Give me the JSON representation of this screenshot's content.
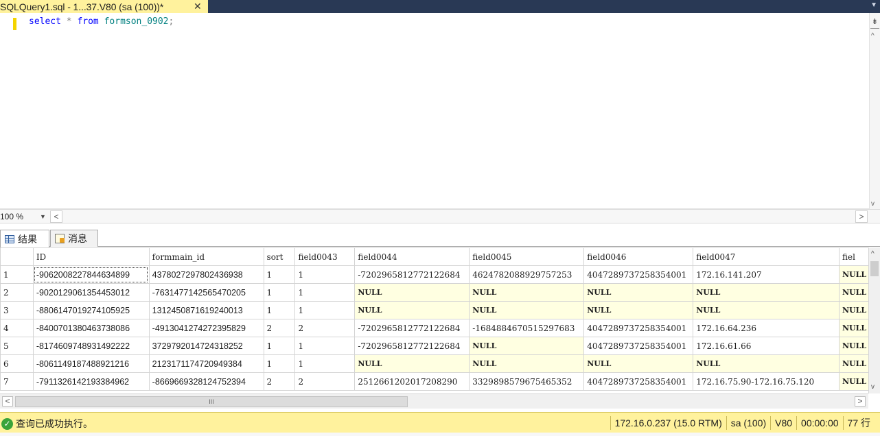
{
  "document_tab": {
    "title": "SQLQuery1.sql - 1...37.V80 (sa (100))*",
    "close_glyph": "✕"
  },
  "editor": {
    "keyword_select": "select",
    "operator_star": "*",
    "keyword_from": "from",
    "table_name": "formson_0902",
    "terminator": ";"
  },
  "zoom": {
    "level": "100 %"
  },
  "results_tabs": [
    {
      "label": "结果",
      "icon": "grid-icon"
    },
    {
      "label": "消息",
      "icon": "message-icon"
    }
  ],
  "grid": {
    "columns": [
      "ID",
      "formmain_id",
      "sort",
      "field0043",
      "field0044",
      "field0045",
      "field0046",
      "field0047",
      "fiel"
    ],
    "rows": [
      [
        "1",
        "-9062008227844634899",
        "4378027297802436938",
        "1",
        "1",
        "-7202965812772122684",
        "4624782088929757253",
        "4047289737258354001",
        "172.16.141.207",
        "NULL"
      ],
      [
        "2",
        "-9020129061354453012",
        "-7631477142565470205",
        "1",
        "1",
        "NULL",
        "NULL",
        "NULL",
        "NULL",
        "NULL"
      ],
      [
        "3",
        "-8806147019274105925",
        "1312450871619240013",
        "1",
        "1",
        "NULL",
        "NULL",
        "NULL",
        "NULL",
        "NULL"
      ],
      [
        "4",
        "-8400701380463738086",
        "-4913041274272395829",
        "2",
        "2",
        "-7202965812772122684",
        "-1684884670515297683",
        "4047289737258354001",
        "172.16.64.236",
        "NULL"
      ],
      [
        "5",
        "-8174609748931492222",
        "3729792014724318252",
        "1",
        "1",
        "-7202965812772122684",
        "NULL",
        "4047289737258354001",
        "172.16.61.66",
        "NULL"
      ],
      [
        "6",
        "-8061149187488921216",
        "2123171174720949384",
        "1",
        "1",
        "NULL",
        "NULL",
        "NULL",
        "NULL",
        "NULL"
      ],
      [
        "7",
        "-7911326142193384962",
        "-8669669328124752394",
        "2",
        "2",
        "2512661202017208290",
        "3329898579675465352",
        "4047289737258354001",
        "172.16.75.90-172.16.75.120",
        "NULL"
      ]
    ],
    "hscroll_grip": "III"
  },
  "status": {
    "message": "查询已成功执行。",
    "server": "172.16.0.237 (15.0 RTM)",
    "login": "sa (100)",
    "database": "V80",
    "elapsed": "00:00:00",
    "row_count": "77 行"
  },
  "colors": {
    "tab_strip": "#293955",
    "active_tab": "#fff29d",
    "status_bar": "#fff29d",
    "null_cell": "#ffffe1",
    "keyword": "#0000ff",
    "identifier": "#008080"
  }
}
